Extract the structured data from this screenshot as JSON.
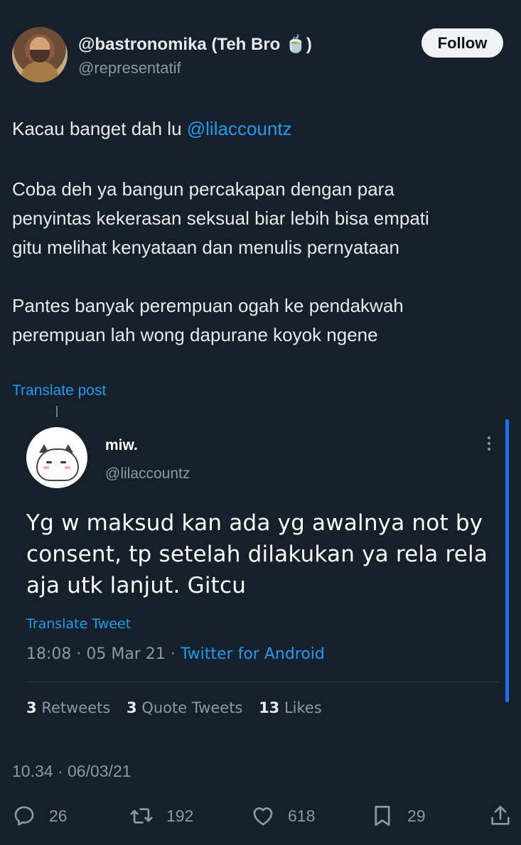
{
  "header": {
    "display_name": "@bastronomika (Teh Bro 🍵)",
    "handle": "@representatif",
    "follow_label": "Follow"
  },
  "post": {
    "line1_prefix": "Kacau banget dah lu ",
    "line1_mention": "@lilaccountz",
    "para2_line1": "Coba deh ya bangun percakapan dengan para",
    "para2_line2": "penyintas kekerasan seksual biar lebih bisa empati",
    "para2_line3": "gitu melihat kenyataan dan menulis pernyataan",
    "para3_line1": "Pantes banyak perempuan ogah ke pendakwah",
    "para3_line2": "perempuan lah wong dapurane koyok ngene",
    "translate_label": "Translate post"
  },
  "quoted": {
    "name": "miw.",
    "handle": "@lilaccountz",
    "text_line1": "Yg w maksud kan ada yg awalnya not by",
    "text_line2": "consent, tp setelah dilakukan ya rela rela",
    "text_line3": "aja utk lanjut. Gitcu",
    "translate_label": "Translate Tweet",
    "time": "18:08",
    "date": "05 Mar 21",
    "source": "Twitter for Android",
    "retweets_count": "3",
    "retweets_label": "Retweets",
    "quotes_count": "3",
    "quotes_label": "Quote Tweets",
    "likes_count": "13",
    "likes_label": "Likes"
  },
  "footer": {
    "timestamp": "10.34 · 06/03/21",
    "replies": "26",
    "reposts": "192",
    "likes": "618",
    "bookmarks": "29"
  },
  "icons": [
    "reply-icon",
    "repost-icon",
    "like-icon",
    "bookmark-icon",
    "share-icon",
    "more-icon"
  ],
  "colors": {
    "background": "#15202b",
    "accent": "#1d9bf0",
    "muted": "#8b98a5"
  }
}
